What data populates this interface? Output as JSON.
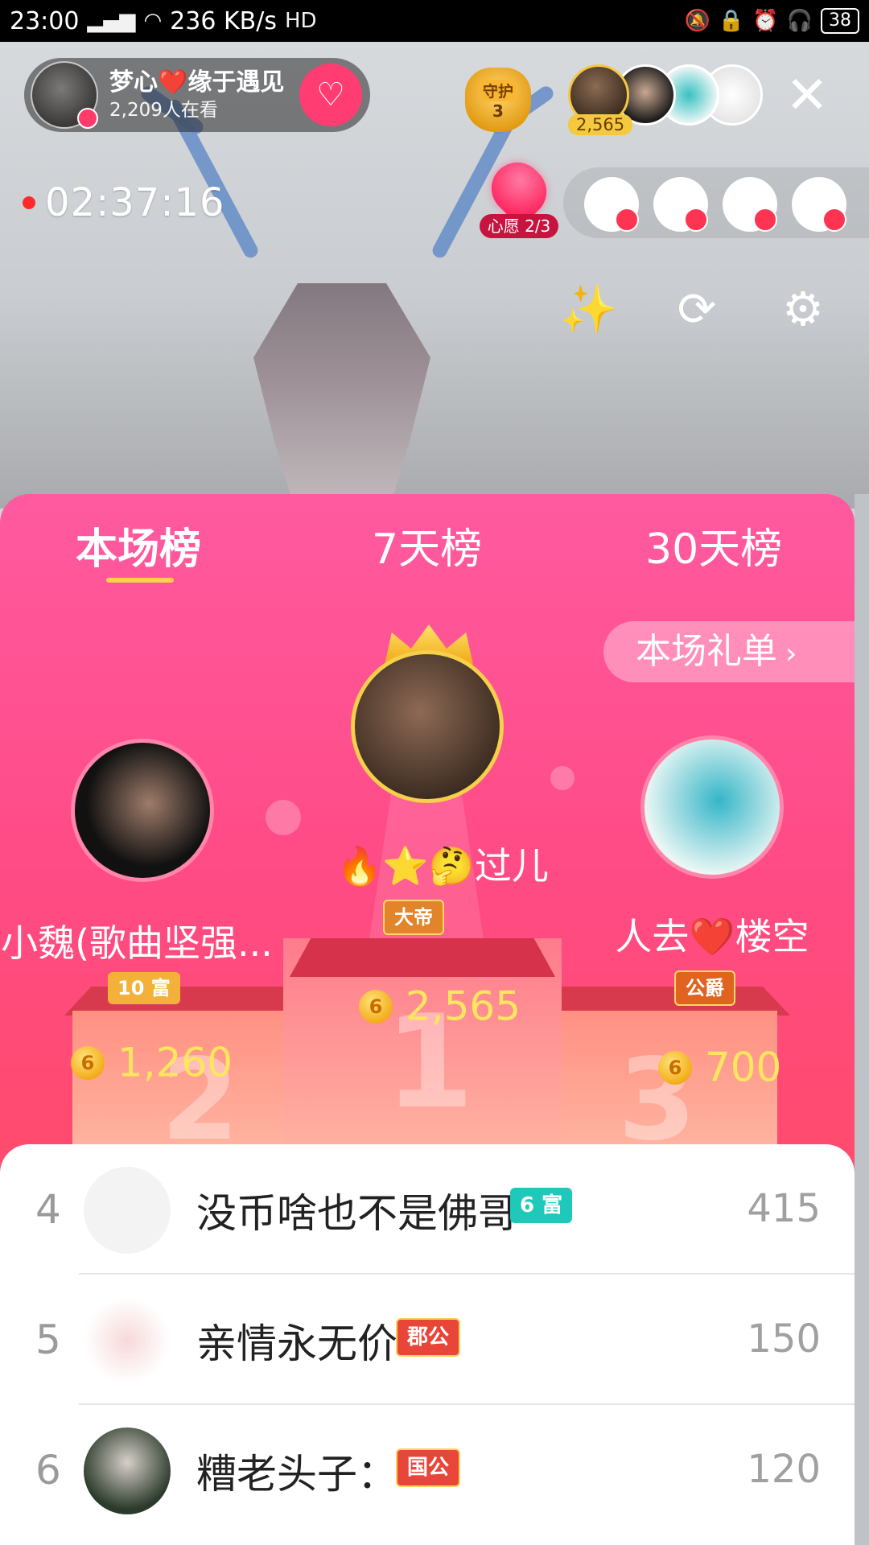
{
  "status_bar": {
    "time": "23:00",
    "network": "4G",
    "speed": "236 KB/s",
    "hd": "HD",
    "battery": "38"
  },
  "live": {
    "host_name": "梦心❤️缘于遇见",
    "viewers": "2,209人在看",
    "guard_label": "守护",
    "guard_count": "3",
    "top_fan_score": "2,565",
    "timer": "02:37:16",
    "wish_label": "心愿 2/3"
  },
  "tabs": [
    {
      "label": "本场榜"
    },
    {
      "label": "7天榜"
    },
    {
      "label": "30天榜"
    }
  ],
  "gift_list_button": {
    "label": "本场礼单",
    "chevron": "›"
  },
  "podium": {
    "first": {
      "name": "🔥⭐🤔过儿",
      "badge": "大帝",
      "score": "2,565"
    },
    "second": {
      "name": "小魏(歌曲坚强...",
      "badge": "10 富",
      "score": "1,260",
      "number": "2"
    },
    "third": {
      "name": "人去❤️楼空",
      "badge": "公爵",
      "score": "700",
      "number": "3"
    },
    "center_number": "1"
  },
  "list": [
    {
      "rank": "4",
      "name": "没币啥也不是佛哥",
      "badge": "6 富",
      "score": "415"
    },
    {
      "rank": "5",
      "name": "亲情永无价",
      "badge": "郡公",
      "score": "150"
    },
    {
      "rank": "6",
      "name": "糟老头子：",
      "badge": "国公",
      "score": "120"
    }
  ],
  "colors": {
    "panel_pink": "#ff5aa0",
    "tab_indicator": "#ffd24a",
    "score_yellow": "#ffe65e",
    "follow_button": "#ff3d72"
  },
  "icons": {
    "close": "✕",
    "follow": "heart-plus-icon",
    "magic": "magic-wand-icon",
    "camera_switch": "camera-switch-icon",
    "settings": "gear-icon",
    "coin": "coin-icon"
  }
}
